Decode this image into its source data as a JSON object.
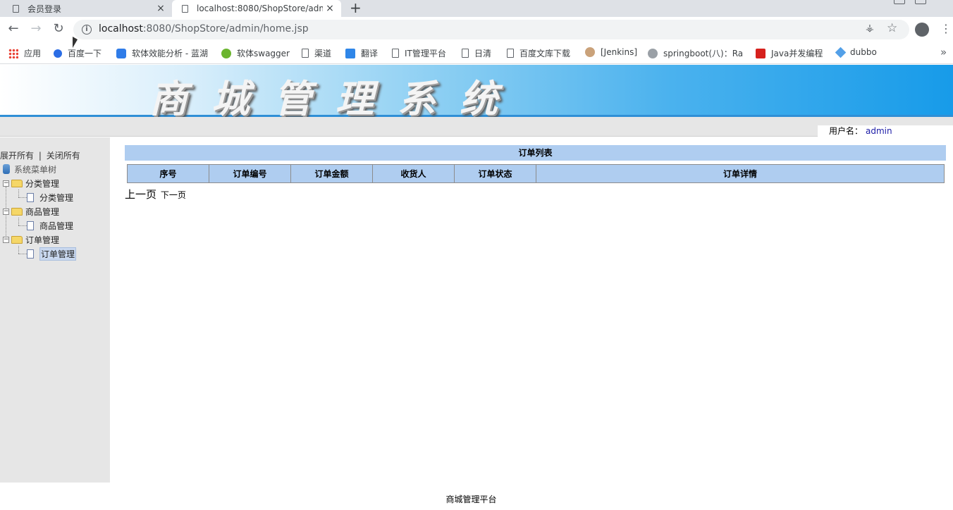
{
  "browser": {
    "tabs": [
      {
        "title": "会员登录",
        "close": "×"
      },
      {
        "title": "localhost:8080/ShopStore/adm",
        "close": "×"
      }
    ],
    "new_tab": "+",
    "url_host": "localhost",
    "url_rest": ":8080/ShopStore/admin/home.jsp",
    "bookmarks": [
      {
        "label": "应用",
        "icon": "apps-icon"
      },
      {
        "label": "百度一下",
        "icon": "baidu-paw-icon"
      },
      {
        "label": "软体效能分析 - 蓝湖",
        "icon": "lanhu-icon"
      },
      {
        "label": "软体swagger",
        "icon": "swagger-icon"
      },
      {
        "label": "渠道",
        "icon": "page-icon"
      },
      {
        "label": "翻译",
        "icon": "translate-icon"
      },
      {
        "label": "IT管理平台",
        "icon": "page-icon"
      },
      {
        "label": "日清",
        "icon": "page-icon"
      },
      {
        "label": "百度文库下载",
        "icon": "page-icon"
      },
      {
        "label": "[Jenkins]",
        "icon": "jenkins-icon"
      },
      {
        "label": "springboot(八)：Ra",
        "icon": "springboot-icon"
      },
      {
        "label": "Java并发编程",
        "icon": "csdn-icon"
      },
      {
        "label": "dubbo",
        "icon": "dubbo-icon"
      }
    ],
    "bookmarks_more": "»"
  },
  "header": {
    "title": "商城管理系统",
    "user_label": "用户名：",
    "user_name": "admin"
  },
  "sidebar": {
    "expand_all": "展开所有",
    "separator": "|",
    "collapse_all": "关闭所有",
    "root": "系统菜单树",
    "groups": [
      {
        "label": "分类管理",
        "child": "分类管理"
      },
      {
        "label": "商品管理",
        "child": "商品管理"
      },
      {
        "label": "订单管理",
        "child": "订单管理"
      }
    ]
  },
  "main": {
    "list_title": "订单列表",
    "columns": [
      "序号",
      "订单编号",
      "订单金额",
      "收货人",
      "订单状态",
      "订单详情"
    ],
    "prev_page": "上一页",
    "next_page": "下一页"
  },
  "footer": {
    "text": "商城管理平台"
  }
}
